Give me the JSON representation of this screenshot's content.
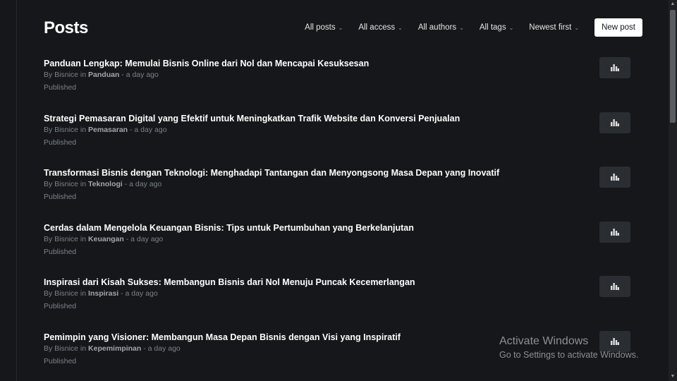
{
  "header": {
    "title": "Posts",
    "filters": [
      {
        "label": "All posts",
        "chevron": "⌄"
      },
      {
        "label": "All access",
        "chevron": "⌄"
      },
      {
        "label": "All authors",
        "chevron": "⌄"
      },
      {
        "label": "All tags",
        "chevron": "⌄"
      },
      {
        "label": "Newest first",
        "chevron": "⌄"
      }
    ],
    "new_post_label": "New post"
  },
  "posts": [
    {
      "title": "Panduan Lengkap: Memulai Bisnis Online dari Nol dan Mencapai Kesuksesan",
      "by": "By Bisnice in",
      "tag": "Panduan",
      "time": "- a day ago",
      "status": "Published"
    },
    {
      "title": "Strategi Pemasaran Digital yang Efektif untuk Meningkatkan Trafik Website dan Konversi Penjualan",
      "by": "By Bisnice in",
      "tag": "Pemasaran",
      "time": "- a day ago",
      "status": "Published"
    },
    {
      "title": "Transformasi Bisnis dengan Teknologi: Menghadapi Tantangan dan Menyongsong Masa Depan yang Inovatif",
      "by": "By Bisnice in",
      "tag": "Teknologi",
      "time": "- a day ago",
      "status": "Published"
    },
    {
      "title": "Cerdas dalam Mengelola Keuangan Bisnis: Tips untuk Pertumbuhan yang Berkelanjutan",
      "by": "By Bisnice in",
      "tag": "Keuangan",
      "time": "- a day ago",
      "status": "Published"
    },
    {
      "title": "Inspirasi dari Kisah Sukses: Membangun Bisnis dari Nol Menuju Puncak Kecemerlangan",
      "by": "By Bisnice in",
      "tag": "Inspirasi",
      "time": "- a day ago",
      "status": "Published"
    },
    {
      "title": "Pemimpin yang Visioner: Membangun Masa Depan Bisnis dengan Visi yang Inspiratif",
      "by": "By Bisnice in",
      "tag": "Kepemimpinan",
      "time": "- a day ago",
      "status": "Published"
    }
  ],
  "icons": {
    "analytics": "bar-chart-icon"
  },
  "scrollbar": {
    "up": "▲",
    "down": "▼"
  },
  "watermark": {
    "title": "Activate Windows",
    "subtitle": "Go to Settings to activate Windows."
  },
  "colors": {
    "background": "#15171a",
    "button_bg": "#2a2d31",
    "text_primary": "#ffffff",
    "text_muted": "#7c8288"
  }
}
